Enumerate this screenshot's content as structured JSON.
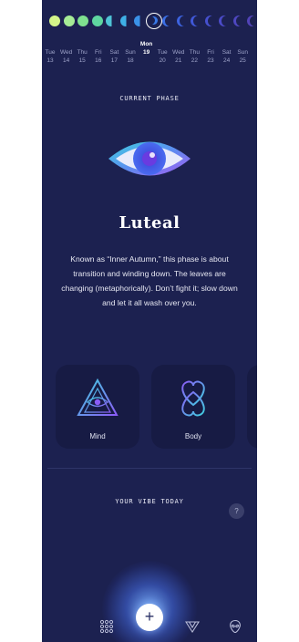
{
  "calendar": {
    "moons": [
      {
        "color": "#d4f58a",
        "shape": "full"
      },
      {
        "color": "#a6ec96",
        "shape": "full"
      },
      {
        "color": "#7fe08f",
        "shape": "full"
      },
      {
        "color": "#5fd6a0",
        "shape": "full"
      },
      {
        "color": "#4fc3d6",
        "shape": "waning"
      },
      {
        "color": "#3fb0e6",
        "shape": "waning"
      },
      {
        "color": "#3a92e8",
        "shape": "waning"
      },
      {
        "color": "#ffffff",
        "shape": "selected"
      },
      {
        "color": "#3b6fe6",
        "shape": "crescent"
      },
      {
        "color": "#3d63e0",
        "shape": "crescent"
      },
      {
        "color": "#4058d8",
        "shape": "crescent"
      },
      {
        "color": "#4650cf",
        "shape": "crescent"
      },
      {
        "color": "#4b4bc8",
        "shape": "crescent"
      },
      {
        "color": "#4f47c0",
        "shape": "crescent"
      },
      {
        "color": "#5243b8",
        "shape": "crescent"
      }
    ],
    "days": [
      {
        "name": "Tue",
        "num": "13"
      },
      {
        "name": "Wed",
        "num": "14"
      },
      {
        "name": "Thu",
        "num": "15"
      },
      {
        "name": "Fri",
        "num": "16"
      },
      {
        "name": "Sat",
        "num": "17"
      },
      {
        "name": "Sun",
        "num": "18"
      },
      {
        "name": "Mon",
        "num": "19",
        "today": true
      },
      {
        "name": "Tue",
        "num": "20"
      },
      {
        "name": "Wed",
        "num": "21"
      },
      {
        "name": "Thu",
        "num": "22"
      },
      {
        "name": "Fri",
        "num": "23"
      },
      {
        "name": "Sat",
        "num": "24"
      },
      {
        "name": "Sun",
        "num": "25"
      }
    ]
  },
  "phase": {
    "section_title": "CURRENT PHASE",
    "name": "Luteal",
    "description": "Known as “Inner Autumn,” this phase is about transition and winding down. The leaves are changing (metaphorically). Don’t fight it; slow down and let it all wash over you.",
    "icon": "eye-icon"
  },
  "cards": [
    {
      "label": "Mind",
      "icon": "pyramid-eye-icon"
    },
    {
      "label": "Body",
      "icon": "interlocked-hearts-icon"
    }
  ],
  "vibe": {
    "section_title": "YOUR VIBE TODAY",
    "help_label": "?"
  },
  "nav": {
    "items": [
      "moon-icon",
      "grid-icon",
      "add-icon",
      "triangles-icon",
      "alien-icon"
    ],
    "fab_label": "+"
  },
  "colors": {
    "background": "#1c2150",
    "card": "#171b44",
    "accent_teal": "#3fd1e0",
    "accent_purple": "#8b5cf6"
  }
}
